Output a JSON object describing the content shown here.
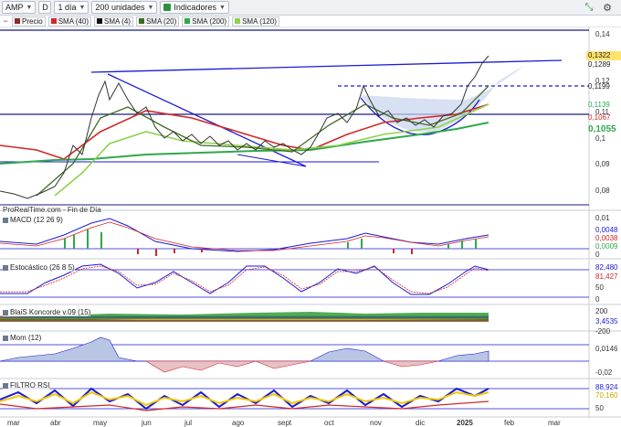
{
  "toolbar": {
    "symbol": "AMP",
    "d_button": "D",
    "timeframe": "1 día",
    "units": "200 unidades",
    "indicators": "Indicadores"
  },
  "legend": [
    {
      "label": "Precio",
      "color": "#8a2b2b"
    },
    {
      "label": "SMA (40)",
      "color": "#d42626"
    },
    {
      "label": "SMA (4)",
      "color": "#111111"
    },
    {
      "label": "SMA (20)",
      "color": "#3f6b1f"
    },
    {
      "label": "SMA (200)",
      "color": "#2fa84a"
    },
    {
      "label": "SMA (120)",
      "color": "#8fd14f"
    }
  ],
  "watermark": "ProRealTime.com - Fin de Día",
  "price_axis": [
    "0,14",
    "0,12",
    "0,11",
    "0,1",
    "0,09",
    "0,08"
  ],
  "price_tags": [
    {
      "text": "0,1322",
      "bg": "#ffe36e",
      "color": "#222"
    },
    {
      "text": "0,1289",
      "bg": "#ffffff",
      "color": "#222"
    },
    {
      "text": "0,1199",
      "bg": "#ffffff",
      "color": "#222"
    },
    {
      "text": "0,1139",
      "bg": "#ffffff",
      "color": "#2fa84a"
    },
    {
      "text": "0,1067",
      "bg": "#ffffff",
      "color": "#d42626"
    },
    {
      "text": "0,1055",
      "bg": "#ffffff",
      "color": "#2fa84a"
    }
  ],
  "panels": {
    "macd": {
      "label": "MACD (12 26 9)",
      "axis": [
        "0,01",
        "0,0048",
        "0,0038",
        "0,0009",
        "0"
      ]
    },
    "stoch": {
      "label": "Estocástico (26 8 5)",
      "axis": [
        "82,480",
        "81,427",
        "50",
        "0"
      ]
    },
    "koncorde": {
      "label": "BlaiS Koncorde v.09 (15)",
      "axis": [
        "200",
        "3,4535",
        "-200"
      ]
    },
    "mom": {
      "label": "Mom (12)",
      "axis": [
        "0,0146",
        "-0,02"
      ]
    },
    "filtro": {
      "label": "FILTRO RSI",
      "axis": [
        "88,924",
        "70,160",
        "50"
      ]
    }
  },
  "months": [
    "mar",
    "abr",
    "may",
    "jun",
    "jul",
    "ago",
    "sept",
    "oct",
    "nov",
    "dic",
    "2025",
    "feb",
    "mar"
  ],
  "colors": {
    "trend": "#1a1ad6",
    "support": "#1a1a80",
    "sma40": "#d42626",
    "sma200": "#2fa84a",
    "sma120": "#8fd14f",
    "sma20": "#3f6b1f"
  }
}
